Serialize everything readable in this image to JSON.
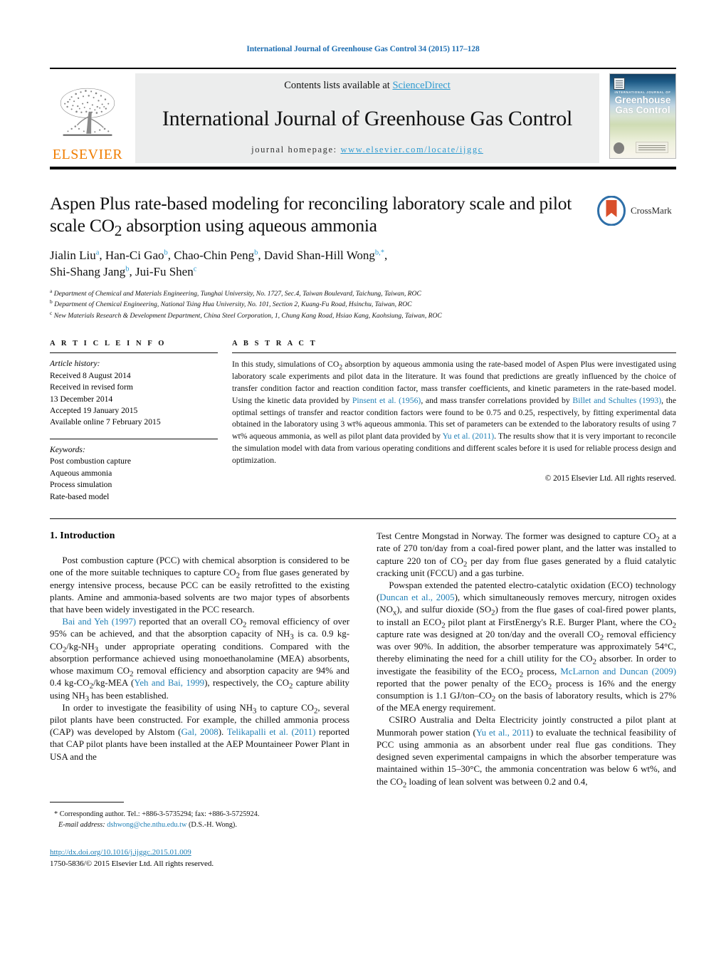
{
  "running_head": "International Journal of Greenhouse Gas Control 34 (2015) 117–128",
  "masthead": {
    "contents_prefix": "Contents lists available at ",
    "sciencedirect": "ScienceDirect",
    "journal_title": "International Journal of Greenhouse Gas Control",
    "homepage_label": "journal homepage:",
    "homepage_url": "www.elsevier.com/locate/ijggc",
    "publisher": "ELSEVIER",
    "cover": {
      "kicker": "INTERNATIONAL JOURNAL OF",
      "title_line1": "Greenhouse",
      "title_line2": "Gas Control"
    }
  },
  "article": {
    "title": "Aspen Plus rate-based modeling for reconciling laboratory scale and pilot scale CO2 absorption using aqueous ammonia",
    "title_html": "Aspen Plus rate-based modeling for reconciling laboratory scale and pilot scale CO<sub>2</sub> absorption using aqueous ammonia",
    "authors_html": "Jialin Liu<sup class=\"aff\">a</sup>, Han-Ci Gao<sup class=\"aff\">b</sup>, Chao-Chin Peng<sup class=\"aff\">b</sup>, David Shan-Hill Wong<sup class=\"aff\">b,*</sup>,<br>Shi-Shang Jang<sup class=\"aff\">b</sup>, Jui-Fu Shen<sup class=\"aff\">c</sup>",
    "affiliations": [
      {
        "mark": "a",
        "text": "Department of Chemical and Materials Engineering, Tunghai University, No. 1727, Sec.4, Taiwan Boulevard, Taichung, Taiwan, ROC"
      },
      {
        "mark": "b",
        "text": "Department of Chemical Engineering, National Tsing Hua University, No. 101, Section 2, Kuang-Fu Road, Hsinchu, Taiwan, ROC"
      },
      {
        "mark": "c",
        "text": "New Materials Research & Development Department, China Steel Corporation, 1, Chung Kang Road, Hsiao Kang, Kaohsiung, Taiwan, ROC"
      }
    ],
    "crossmark_label": "CrossMark"
  },
  "info": {
    "heading": "A R T I C L E   I N F O",
    "history_label": "Article history:",
    "history": [
      "Received 8 August 2014",
      "Received in revised form",
      "13 December 2014",
      "Accepted 19 January 2015",
      "Available online 7 February 2015"
    ],
    "keywords_label": "Keywords:",
    "keywords": [
      "Post combustion capture",
      "Aqueous ammonia",
      "Process simulation",
      "Rate-based model"
    ]
  },
  "abstract": {
    "heading": "A B S T R A C T",
    "body_html": "In this study, simulations of CO<sub>2</sub> absorption by aqueous ammonia using the rate-based model of Aspen Plus were investigated using laboratory scale experiments and pilot data in the literature. It was found that predictions are greatly influenced by the choice of transfer condition factor and reaction condition factor, mass transfer coefficients, and kinetic parameters in the rate-based model. Using the kinetic data provided by <a class=\"link\" href=\"#\">Pinsent et al. (1956)</a>, and mass transfer correlations provided by <a class=\"link\" href=\"#\">Billet and Schultes (1993)</a>, the optimal settings of transfer and reactor condition factors were found to be 0.75 and 0.25, respectively, by fitting experimental data obtained in the laboratory using 3 wt% aqueous ammonia. This set of parameters can be extended to the laboratory results of using 7 wt% aqueous ammonia, as well as pilot plant data provided by <a class=\"link\" href=\"#\">Yu et al. (2011)</a>. The results show that it is very important to reconcile the simulation model with data from various operating conditions and different scales before it is used for reliable process design and optimization.",
    "copyright": "© 2015 Elsevier Ltd. All rights reserved."
  },
  "body": {
    "section_number_title": "1.  Introduction",
    "left_paragraphs_html": [
      "Post combustion capture (PCC) with chemical absorption is considered to be one of the more suitable techniques to capture CO<sub>2</sub> from flue gases generated by energy intensive process, because PCC can be easily retrofitted to the existing plants. Amine and ammonia-based solvents are two major types of absorbents that have been widely investigated in the PCC research.",
      "<a class=\"link\" href=\"#\">Bai and Yeh (1997)</a> reported that an overall CO<sub>2</sub> removal efficiency of over 95% can be achieved, and that the absorption capacity of NH<sub>3</sub> is ca. 0.9 kg-CO<sub>2</sub>/kg-NH<sub>3</sub> under appropriate operating conditions. Compared with the absorption performance achieved using monoethanolamine (MEA) absorbents, whose maximum CO<sub>2</sub> removal efficiency and absorption capacity are 94% and 0.4 kg-CO<sub>2</sub>/kg-MEA (<a class=\"link\" href=\"#\">Yeh and Bai, 1999</a>), respectively, the CO<sub>2</sub> capture ability using NH<sub>3</sub> has been established.",
      "In order to investigate the feasibility of using NH<sub>3</sub> to capture CO<sub>2</sub>, several pilot plants have been constructed. For example, the chilled ammonia process (CAP) was developed by Alstom (<a class=\"link\" href=\"#\">Gal, 2008</a>). <a class=\"link\" href=\"#\">Telikapalli et al. (2011)</a> reported that CAP pilot plants have been installed at the AEP Mountaineer Power Plant in USA and the"
    ],
    "right_paragraphs_html": [
      "Test Centre Mongstad in Norway. The former was designed to capture CO<sub>2</sub> at a rate of 270 ton/day from a coal-fired power plant, and the latter was installed to capture 220 ton of CO<sub>2</sub> per day from flue gases generated by a fluid catalytic cracking unit (FCCU) and a gas turbine.",
      "Powspan extended the patented electro-catalytic oxidation (ECO) technology (<a class=\"link\" href=\"#\">Duncan et al., 2005</a>), which simultaneously removes mercury, nitrogen oxides (NO<sub>x</sub>), and sulfur dioxide (SO<sub>2</sub>) from the flue gases of coal-fired power plants, to install an ECO<sub>2</sub> pilot plant at FirstEnergy's R.E. Burger Plant, where the CO<sub>2</sub> capture rate was designed at 20 ton/day and the overall CO<sub>2</sub> removal efficiency was over 90%. In addition, the absorber temperature was approximately 54&#176;C, thereby eliminating the need for a chill utility for the CO<sub>2</sub> absorber. In order to investigate the feasibility of the ECO<sub>2</sub> process, <a class=\"link\" href=\"#\">McLarnon and Duncan (2009)</a> reported that the power penalty of the ECO<sub>2</sub> process is 16% and the energy consumption is 1.1 GJ/ton–CO<sub>2</sub> on the basis of laboratory results, which is 27% of the MEA energy requirement.",
      "CSIRO Australia and Delta Electricity jointly constructed a pilot plant at Munmorah power station (<a class=\"link\" href=\"#\">Yu et al., 2011</a>) to evaluate the technical feasibility of PCC using ammonia as an absorbent under real flue gas conditions. They designed seven experimental campaigns in which the absorber temperature was maintained within 15–30&#176;C, the ammonia concentration was below 6 wt%, and the CO<sub>2</sub> loading of lean solvent was between 0.2 and 0.4,"
    ]
  },
  "footnote": {
    "corresponding_html": "<span class=\"ind\">*  Corresponding author. Tel.: +886-3-5735294; fax: +886-3-5725924.</span>",
    "email_html": "<span class=\"ind\" style=\"padding-left:22px\"><span class=\"em\">E-mail address:</span> <a class=\"link\" href=\"#\">dshwong@che.nthu.edu.tw</a> (D.S.-H. Wong).</span>"
  },
  "doi_block": {
    "doi_url": "http://dx.doi.org/10.1016/j.ijggc.2015.01.009",
    "issn_line": "1750-5836/© 2015 Elsevier Ltd. All rights reserved."
  },
  "colors": {
    "link_blue": "#1f7fb5",
    "running_head_blue": "#1f6fb2",
    "sciencedirect_blue": "#2e9ad0",
    "elsevier_orange": "#f07d00",
    "crossmark_blue": "#2e6fa8",
    "crossmark_red": "#d94f2b"
  }
}
